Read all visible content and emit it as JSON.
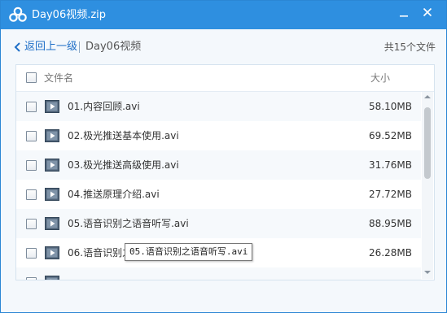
{
  "window": {
    "title": "Day06视频.zip",
    "controls": {
      "minimize_icon": "minimize-icon",
      "close_icon": "close-icon"
    },
    "logo_icon": "cloud-logo-icon",
    "accent_color": "#2e8fe0"
  },
  "nav": {
    "back_label": "返回上一级",
    "breadcrumb": "Day06视频",
    "file_count": "共15个文件"
  },
  "table": {
    "header": {
      "name": "文件名",
      "size": "大小"
    },
    "rows": [
      {
        "name": "01.内容回顾.avi",
        "size": "58.10MB"
      },
      {
        "name": "02.极光推送基本使用.avi",
        "size": "69.52MB"
      },
      {
        "name": "03.极光推送高级使用.avi",
        "size": "31.76MB"
      },
      {
        "name": "04.推送原理介绍.avi",
        "size": "27.72MB"
      },
      {
        "name": "05.语音识别之语音听写.avi",
        "size": "88.95MB"
      },
      {
        "name": "06.语音识别之",
        "size": "26.28MB"
      }
    ]
  },
  "tooltip": {
    "text": "05.语音识别之语音听写.avi"
  }
}
